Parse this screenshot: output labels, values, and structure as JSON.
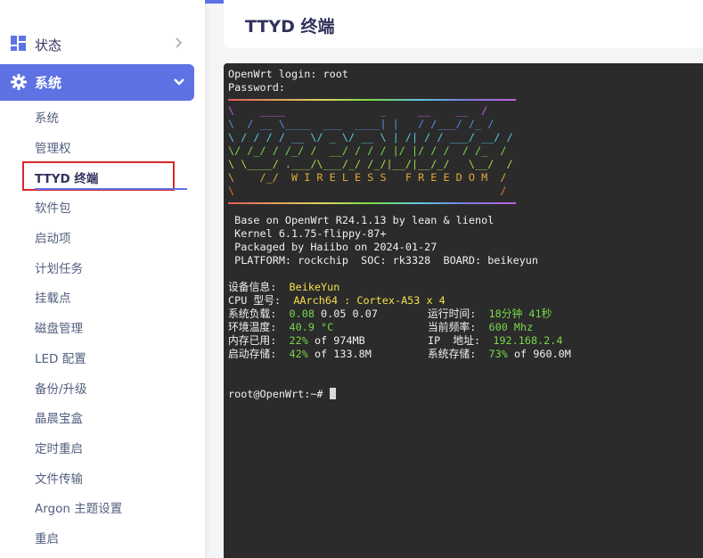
{
  "colors": {
    "accent": "#5e72e4",
    "highlight_box": "#d9262c",
    "terminal_bg": "#2b2b2b",
    "term_green": "#7bd84a",
    "term_yellow": "#f5e04a"
  },
  "sidebar": {
    "status": {
      "label": "状态",
      "icon": "dashboard-icon"
    },
    "system": {
      "label": "系统",
      "icon": "gear-icon"
    },
    "items": [
      "系统",
      "管理权",
      "TTYD 终端",
      "软件包",
      "启动项",
      "计划任务",
      "挂载点",
      "磁盘管理",
      "LED 配置",
      "备份/升级",
      "晶晨宝盒",
      "定时重启",
      "文件传输",
      "Argon 主题设置",
      "重启"
    ],
    "active_index": 2
  },
  "page": {
    "title": "TTYD 终端"
  },
  "terminal": {
    "login": "OpenWrt login: root",
    "password": "Password:",
    "art": [
      "\\    ____               _     __    __  /",
      "\\  / __ \\____  ___  ____| |   / /___/ /_ /",
      "\\ / / / / __ \\/ _ \\/ __ \\ | /| / / ___/ __/ /",
      "\\/ /_/ / /_/ /  __/ / / / |/ |/ / /  / /_  /",
      "\\ \\____/ .___/\\___/_/ /_/|__/|__/_/   \\__/  /",
      "\\    /_/  W I R E L E S S   F R E E D O M  /",
      "\\                                          /"
    ],
    "info": [
      " Base on OpenWrt R24.1.13 by lean & lienol",
      " Kernel 6.1.75-flippy-87+",
      " Packaged by Haiibo on 2024-01-27",
      " PLATFORM: rockchip  SOC: rk3328  BOARD: beikeyun"
    ],
    "device_label": "设备信息:",
    "device_value": "BeikeYun",
    "cpu_label": "CPU 型号:",
    "cpu_value": "AArch64 : Cortex-A53 x 4",
    "load_label": "系统负载:",
    "load_first": "0.08",
    "load_rest": "0.05 0.07",
    "uptime_label": "运行时间:",
    "uptime_value": "18分钟 41秒",
    "temp_label": "环境温度:",
    "temp_value": "40.9 °C",
    "freq_label": "当前频率:",
    "freq_value": "600 Mhz",
    "mem_label": "内存已用:",
    "mem_pct": "22%",
    "mem_rest": "of 974MB",
    "ip_label": "IP  地址:",
    "ip_value": "192.168.2.4",
    "boot_label": "启动存储:",
    "boot_pct": "42%",
    "boot_rest": "of 133.8M",
    "sys_label": "系统存储:",
    "sys_pct": "73%",
    "sys_rest": "of 960.0M",
    "prompt": "root@OpenWrt:~#"
  }
}
